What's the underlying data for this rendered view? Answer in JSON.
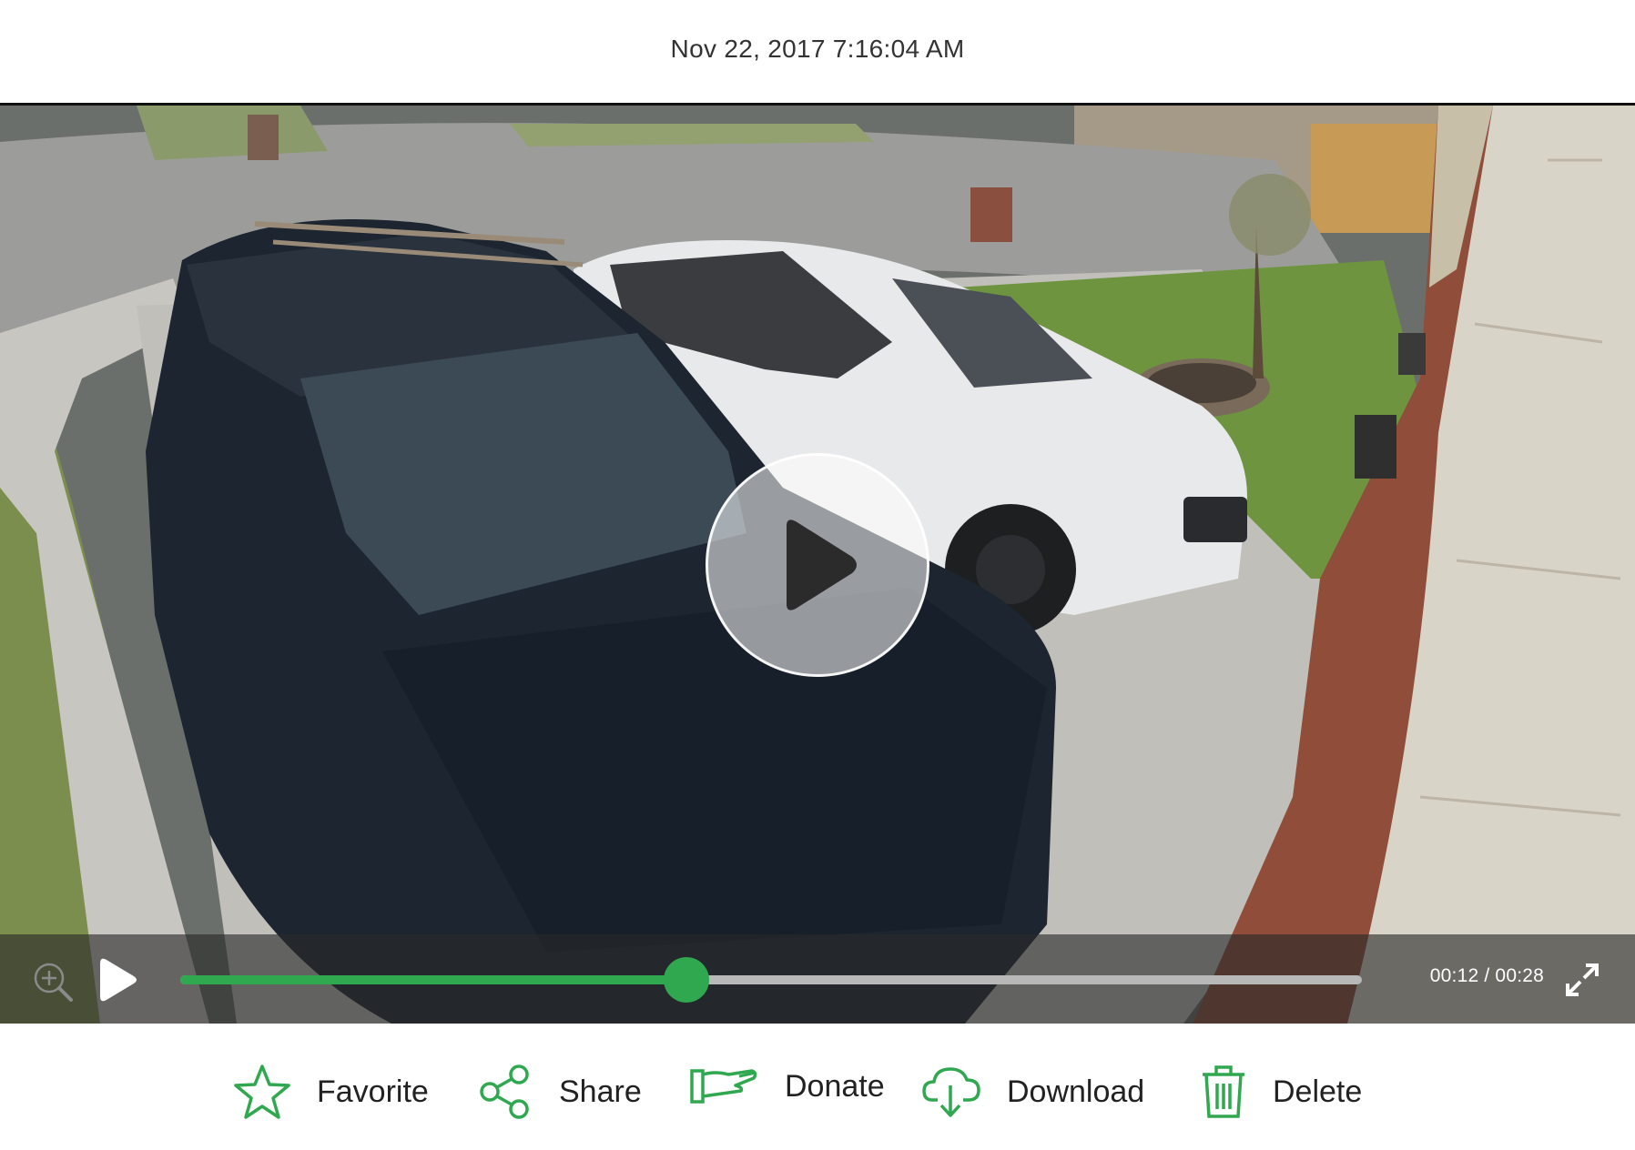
{
  "header": {
    "timestamp": "Nov 22, 2017 7:16:04 AM"
  },
  "player": {
    "time_display": "00:12 / 00:28",
    "progress": 0.4286,
    "icons": {
      "zoom": "zoom-in-icon",
      "play": "play-icon",
      "big_play": "play-icon",
      "fullscreen": "fullscreen-icon"
    }
  },
  "actions": [
    {
      "label": "Favorite",
      "icon": "star-icon"
    },
    {
      "label": "Share",
      "icon": "share-icon"
    },
    {
      "label": "Donate",
      "icon": "donate-hand-icon"
    },
    {
      "label": "Download",
      "icon": "cloud-download-icon"
    },
    {
      "label": "Delete",
      "icon": "trash-icon"
    }
  ],
  "colors": {
    "accent": "#2fa84f",
    "header_text": "#333333",
    "action_text": "#222222"
  }
}
